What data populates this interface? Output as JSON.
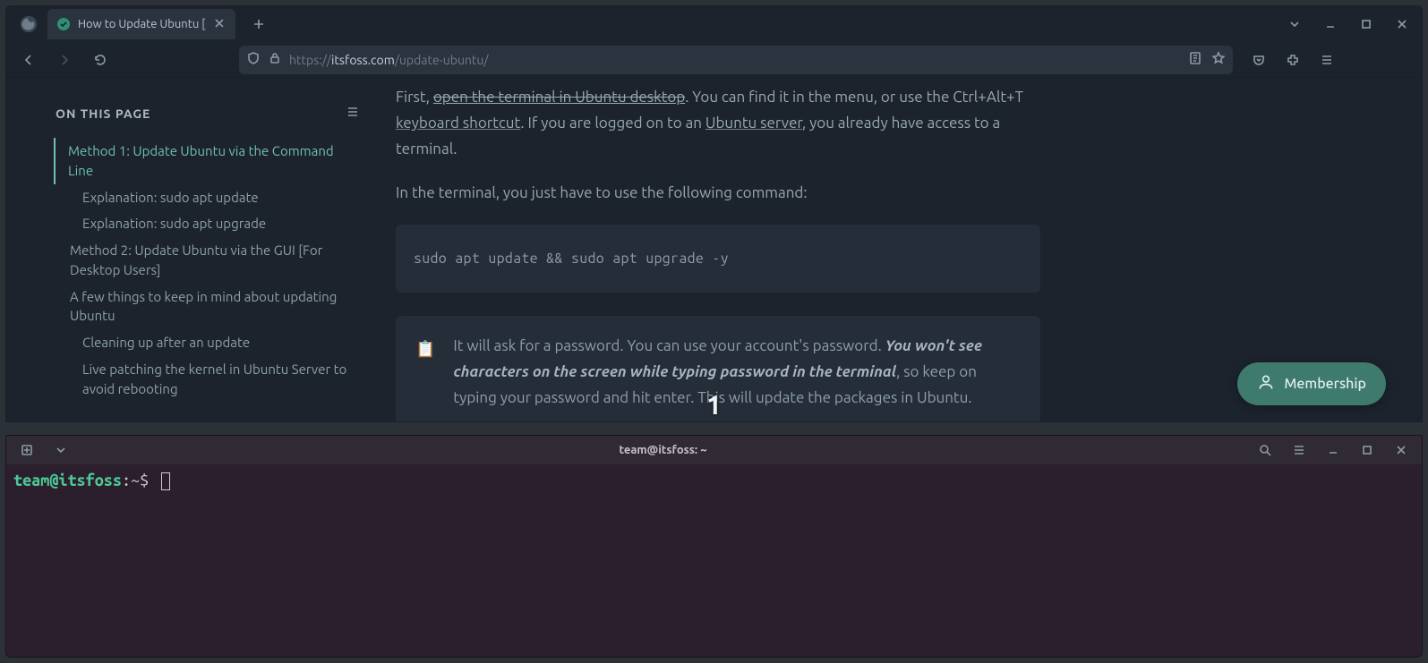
{
  "browser": {
    "tab_title": "How to Update Ubuntu [",
    "url_scheme": "https://",
    "url_host": "itsfoss.com",
    "url_path": "/update-ubuntu/"
  },
  "toc": {
    "title": "ON THIS PAGE",
    "items": [
      {
        "label": "Method 1: Update Ubuntu via the Command Line",
        "active": true,
        "indent": false
      },
      {
        "label": "Explanation: sudo apt update",
        "active": false,
        "indent": true
      },
      {
        "label": "Explanation: sudo apt upgrade",
        "active": false,
        "indent": true
      },
      {
        "label": "Method 2: Update Ubuntu via the GUI [For Desktop Users]",
        "active": false,
        "indent": false
      },
      {
        "label": "A few things to keep in mind about updating Ubuntu",
        "active": false,
        "indent": false
      },
      {
        "label": "Cleaning up after an update",
        "active": false,
        "indent": true
      },
      {
        "label": "Live patching the kernel in Ubuntu Server to avoid rebooting",
        "active": false,
        "indent": true
      }
    ]
  },
  "article": {
    "p1_a": "First, ",
    "p1_link1": "open the terminal in Ubuntu desktop",
    "p1_b": ". You can find it in the menu, or use the Ctrl+Alt+T ",
    "p1_link2": "keyboard shortcut",
    "p1_c": ". If you are logged on to an ",
    "p1_link3": "Ubuntu server",
    "p1_d": ", you already have access to a terminal.",
    "p2": "In the terminal, you just have to use the following command:",
    "code": "sudo apt update && sudo apt upgrade -y",
    "callout_a": "It will ask for a password. You can use your account's password. ",
    "callout_em": "You won't see characters on the screen while typing password in the terminal",
    "callout_b": ", so keep on typing your password and hit enter. This will update the packages in Ubuntu."
  },
  "overlay_number": "1",
  "membership_label": "Membership",
  "terminal": {
    "title": "team@itsfoss: ~",
    "prompt_user": "team@itsfoss",
    "prompt_sep": ":",
    "prompt_path": "~",
    "prompt_dollar": "$"
  }
}
